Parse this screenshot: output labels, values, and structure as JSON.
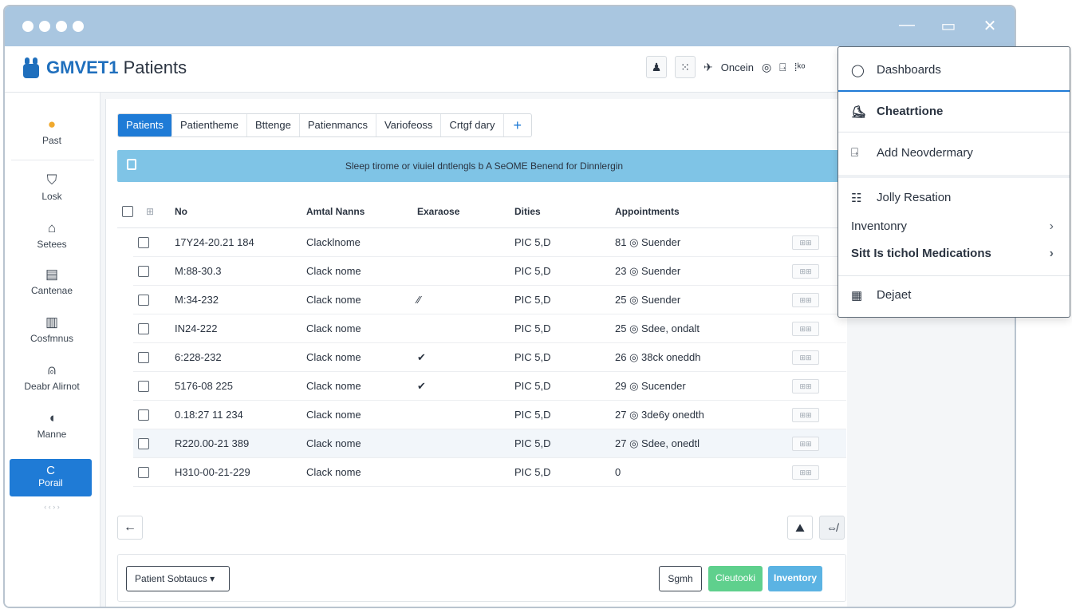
{
  "window": {
    "controls": [
      "—",
      "▭",
      "✕"
    ]
  },
  "header": {
    "brand_bold": "GMVET1",
    "brand_rest": " Patients",
    "tools": [
      "♟",
      "⁙",
      "✈",
      "Oncein",
      "◎",
      "⍈",
      "⁞ᵏᵒ"
    ],
    "tool_label": "Oncein"
  },
  "sidebar": {
    "items": [
      {
        "label": "Past",
        "icon": "●"
      },
      {
        "label": "Losk",
        "icon": "⛉"
      },
      {
        "label": "Setees",
        "icon": "⌂"
      },
      {
        "label": "Cantenae",
        "icon": "▤"
      },
      {
        "label": "Cosfmnus",
        "icon": "▥"
      },
      {
        "label": "Deabr Alirnot",
        "icon": "⍝"
      },
      {
        "label": "Manne",
        "icon": "◖"
      }
    ],
    "active": {
      "label": "Porail",
      "icon": "C",
      "sublabel": "‹ ‹ › ›"
    }
  },
  "tabs": [
    "Patients",
    "Patientheme",
    "Bttenge",
    "Patienmancs",
    "Variofeoss",
    "Crtgf dary",
    "+"
  ],
  "banner": {
    "text": "Sleep tirome or viuiel dntlengls b A SeOME Benend for Dinnlergin"
  },
  "table": {
    "headers": [
      "No",
      "Amtal Nanns",
      "Exaraose",
      "Dities",
      "Appointments"
    ],
    "rows": [
      {
        "no": "17Y24-20.21 184",
        "name": "Clacklnome",
        "ex": "",
        "dities": "PIC 5,D",
        "appt": "81 ◎ Suender",
        "mini": "⊞⊞"
      },
      {
        "no": "M:88-30.3",
        "name": "Clack nome",
        "ex": "",
        "dities": "PIC 5,D",
        "appt": "23 ◎ Suender",
        "mini": "⊞⊞"
      },
      {
        "no": "M:34-232",
        "name": "Clack nome",
        "ex": "⁄⁄",
        "dities": "PIC 5,D",
        "appt": "25 ◎ Suender",
        "mini": "⊞⊞"
      },
      {
        "no": "IN24-222",
        "name": "Clack nome",
        "ex": "",
        "dities": "PIC 5,D",
        "appt": "25 ◎ Sdee, ondalt",
        "mini": "⊞⊞"
      },
      {
        "no": "6:228-232",
        "name": "Clack nome",
        "ex": "✔",
        "dities": "PIC 5,D",
        "appt": "26 ◎ 38ck oneddh",
        "mini": "⊞⊞"
      },
      {
        "no": "5176-08 225",
        "name": "Clack nome",
        "ex": "✔",
        "dities": "PIC 5,D",
        "appt": "29 ◎ Sucender",
        "mini": "⊞⊞"
      },
      {
        "no": "0.18:27 11 234",
        "name": "Clack nome",
        "ex": "",
        "dities": "PIC 5,D",
        "appt": "27 ◎ 3de6y onedth",
        "mini": "⊞⊞"
      },
      {
        "no": "R220.00-21 389",
        "name": "Clack nome",
        "ex": "",
        "dities": "PIC 5,D",
        "appt": "27 ◎ Sdee, onedtl",
        "mini": "⊞⊞"
      },
      {
        "no": "H310-00-21-229",
        "name": "Clack nome",
        "ex": "",
        "dities": "PIC 5,D",
        "appt": "0",
        "mini": "⊞⊞"
      }
    ]
  },
  "nav": {
    "back_icon": "←",
    "right_icons": [
      "⛰",
      "⇎"
    ]
  },
  "footer": {
    "select_label": "Patient Sobtaucs",
    "buttons": [
      "Sgmh",
      "Cleutooki",
      "Inventory"
    ]
  },
  "dropdown": {
    "items": [
      {
        "label": "Dashboards",
        "icon": "◯"
      },
      {
        "label": "Cheatrtione",
        "icon": "⛸"
      },
      {
        "label": "Add Neovdermary",
        "icon": "⍈"
      },
      {
        "label": "Jolly Resation",
        "icon": "☷"
      },
      {
        "label": "Inventonry",
        "icon": "",
        "chevron": "›"
      },
      {
        "label": "Sitt Is tichol Medications",
        "icon": "",
        "chevron": "›"
      },
      {
        "label": "Dejaet",
        "icon": "▦"
      }
    ]
  }
}
